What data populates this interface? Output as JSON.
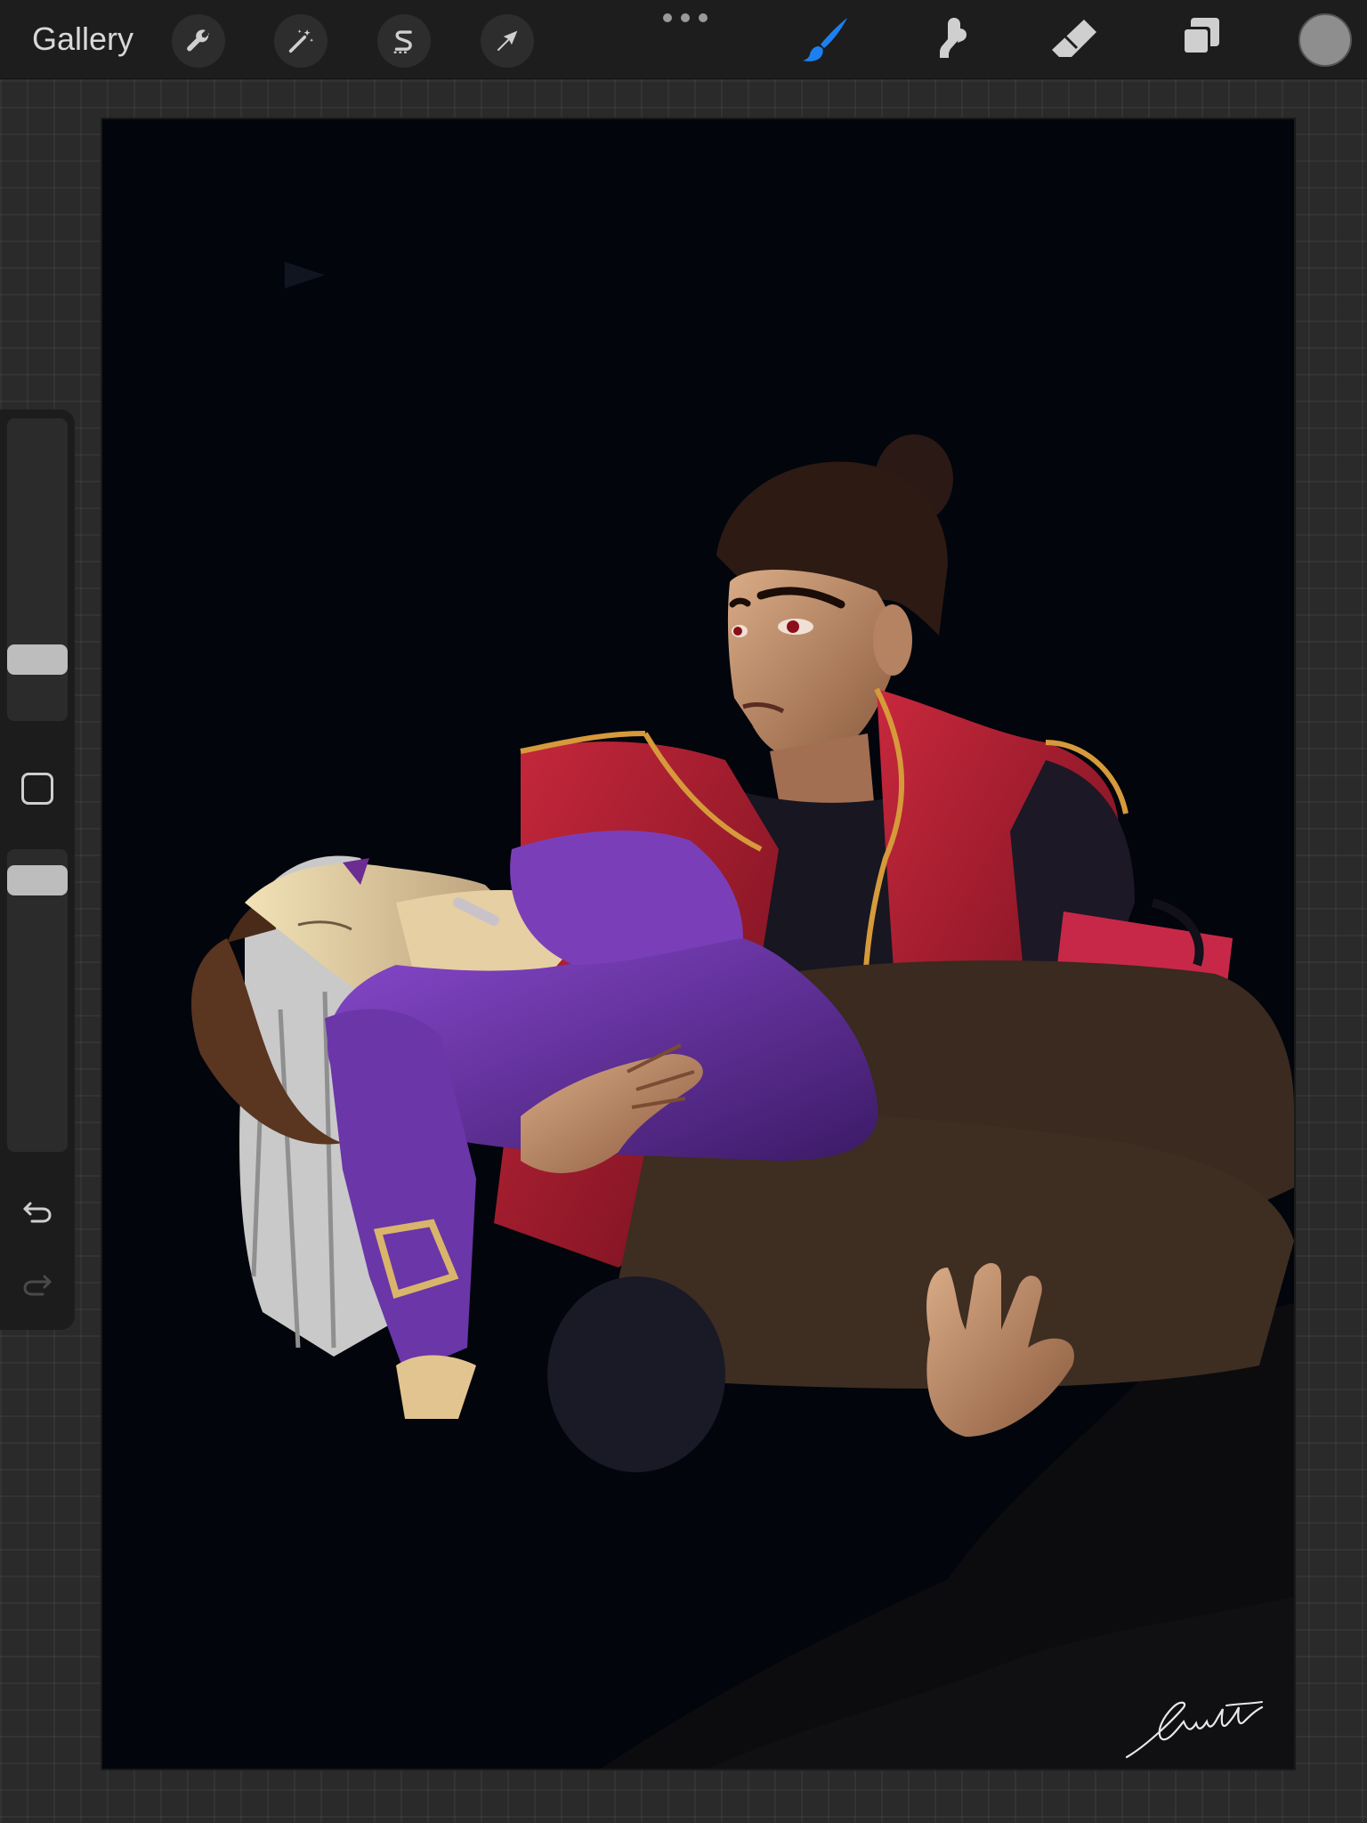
{
  "toolbar": {
    "gallery_label": "Gallery",
    "left_tools": [
      {
        "name": "actions",
        "icon": "wrench-icon"
      },
      {
        "name": "adjustments",
        "icon": "magic-wand-icon"
      },
      {
        "name": "selection",
        "icon": "selection-s-icon"
      },
      {
        "name": "transform",
        "icon": "arrow-cursor-icon"
      }
    ],
    "more_icon": "more-dots-icon",
    "right_tools": [
      {
        "name": "brush",
        "icon": "brush-icon",
        "active": true
      },
      {
        "name": "smudge",
        "icon": "smudge-icon",
        "active": false
      },
      {
        "name": "eraser",
        "icon": "eraser-icon",
        "active": false
      },
      {
        "name": "layers",
        "icon": "layers-icon",
        "active": false
      }
    ],
    "current_color": "#8e8e8e",
    "active_tool_color": "#1e7ff0"
  },
  "sidebar": {
    "brush_size_slider": {
      "icon": "size-slider"
    },
    "modify_button_icon": "square-icon",
    "opacity_slider": {
      "icon": "opacity-slider"
    },
    "undo_icon": "undo-icon",
    "redo_icon": "redo-icon"
  },
  "canvas": {
    "background_color": "#02050c",
    "artwork": "signature-artwork"
  }
}
